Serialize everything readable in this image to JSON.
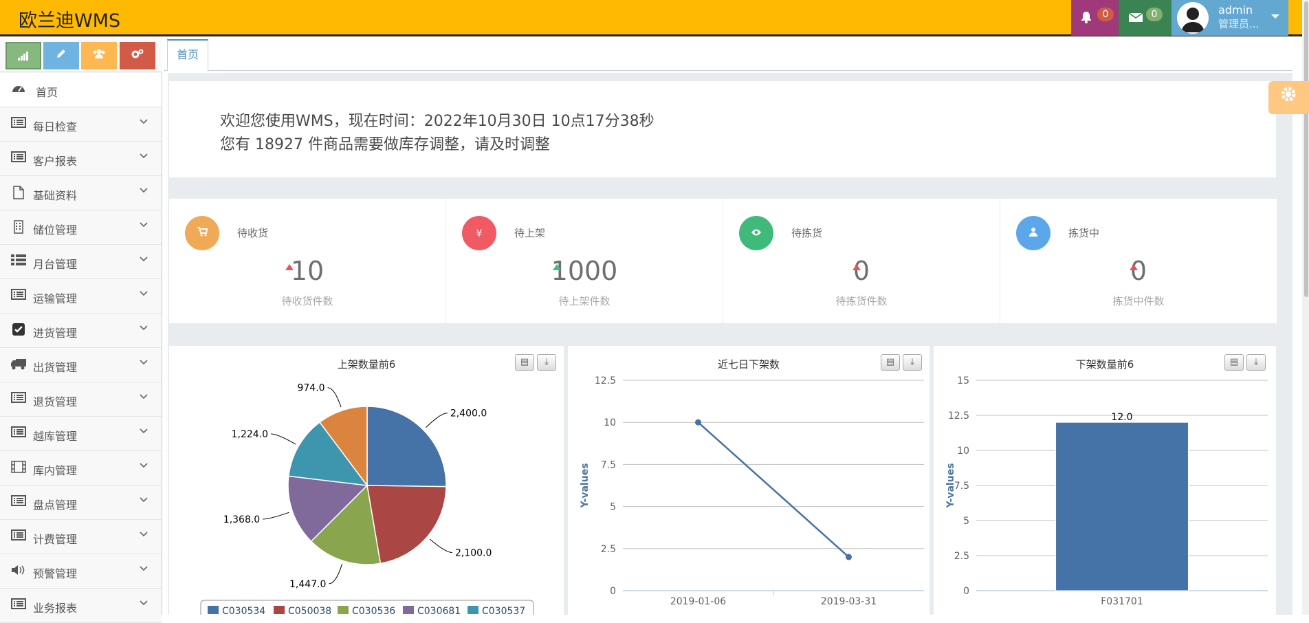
{
  "app": {
    "brand": "欧兰迪WMS"
  },
  "navbar": {
    "notifications": {
      "icon": "bell-icon",
      "count": "0"
    },
    "messages": {
      "icon": "envelope-icon",
      "count": "0"
    },
    "user": {
      "name": "admin",
      "role": "管理员..."
    }
  },
  "sidebar": {
    "shortcuts": [
      {
        "icon": "signal-icon",
        "color": "#87B87F"
      },
      {
        "icon": "pencil-icon",
        "color": "#6FB3E0"
      },
      {
        "icon": "users-icon",
        "color": "#FFB752"
      },
      {
        "icon": "cogs-icon",
        "color": "#D15B47"
      }
    ],
    "items": [
      {
        "label": "首页",
        "icon": "dashboard-icon"
      },
      {
        "label": "每日检查",
        "icon": "list-icon"
      },
      {
        "label": "客户报表",
        "icon": "list-icon"
      },
      {
        "label": "基础资料",
        "icon": "file-icon"
      },
      {
        "label": "储位管理",
        "icon": "building-icon"
      },
      {
        "label": "月台管理",
        "icon": "th-list-icon"
      },
      {
        "label": "运输管理",
        "icon": "list-icon"
      },
      {
        "label": "进货管理",
        "icon": "check-square-icon"
      },
      {
        "label": "出货管理",
        "icon": "truck-icon"
      },
      {
        "label": "退货管理",
        "icon": "list-icon"
      },
      {
        "label": "越库管理",
        "icon": "list-icon"
      },
      {
        "label": "库内管理",
        "icon": "film-icon"
      },
      {
        "label": "盘点管理",
        "icon": "list-icon"
      },
      {
        "label": "计费管理",
        "icon": "list-icon"
      },
      {
        "label": "预警管理",
        "icon": "volume-icon"
      },
      {
        "label": "业务报表",
        "icon": "list-icon"
      }
    ]
  },
  "tabs": [
    {
      "label": "首页",
      "active": true
    }
  ],
  "welcome": {
    "line1": "欢迎您使用WMS，现在时间：2022年10月30日 10点17分38秒",
    "line2": "您有 18927 件商品需要做库存调整，请及时调整"
  },
  "stats": [
    {
      "title": "待收货",
      "value": "10",
      "subtitle": "待收货件数",
      "icon": "cart-icon",
      "color": "#F0A956",
      "trend": "up",
      "trend_color": "#E2565A"
    },
    {
      "title": "待上架",
      "value": "1000",
      "subtitle": "待上架件数",
      "icon": "yen-icon",
      "color": "#F05B63",
      "trend": "up",
      "trend_color": "#3BBE86"
    },
    {
      "title": "待拣货",
      "value": "0",
      "subtitle": "待拣货件数",
      "icon": "eye-icon",
      "color": "#3FBA7B",
      "trend": "up",
      "trend_color": "#E2565A"
    },
    {
      "title": "拣货中",
      "value": "0",
      "subtitle": "拣货中件数",
      "icon": "user-icon",
      "color": "#5CA7E9",
      "trend": "up",
      "trend_color": "#E2565A"
    }
  ],
  "chart_data": [
    {
      "type": "pie",
      "title": "上架数量前6",
      "labels": [
        "C030534",
        "C050038",
        "C030536",
        "C030681",
        "C030537",
        ""
      ],
      "values": [
        2400.0,
        2100.0,
        1447.0,
        1368.0,
        1224.0,
        974.0
      ],
      "data_labels": [
        "2,400.0",
        "2,100.0",
        "1,447.0",
        "1,368.0",
        "1,224.0",
        "974.0"
      ],
      "colors": [
        "#4572A7",
        "#AA4643",
        "#89A54E",
        "#80699B",
        "#3D96AE",
        "#DB843D"
      ],
      "legend": "bottom"
    },
    {
      "type": "line",
      "title": "近七日下架数",
      "categories": [
        "2019-01-06",
        "2019-03-31"
      ],
      "values": [
        10,
        2
      ],
      "ylabel": "Y-values",
      "ylim": [
        0,
        12.5
      ],
      "yticks": [
        "0",
        "2.5",
        "5",
        "7.5",
        "10",
        "12.5"
      ],
      "color": "#4572A7",
      "grid": true
    },
    {
      "type": "bar",
      "title": "下架数量前6",
      "categories": [
        "F031701"
      ],
      "values": [
        12.0
      ],
      "data_labels": [
        "12.0"
      ],
      "ylabel": "Y-values",
      "ylim": [
        0,
        15
      ],
      "yticks": [
        "0",
        "2.5",
        "5",
        "7.5",
        "10",
        "12.5",
        "15"
      ],
      "color": "#4572A7",
      "grid": true
    }
  ]
}
